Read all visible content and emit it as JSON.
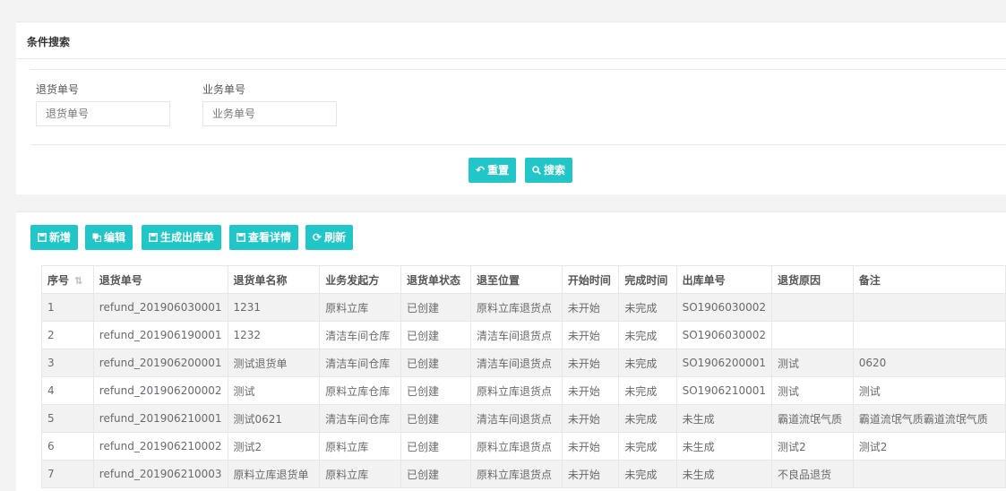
{
  "search": {
    "title": "条件搜索",
    "fields": [
      {
        "label": "退货单号",
        "placeholder": "退货单号",
        "value": ""
      },
      {
        "label": "业务单号",
        "placeholder": "业务单号",
        "value": ""
      }
    ],
    "reset_label": "重置",
    "search_label": "搜索"
  },
  "toolbar": {
    "add_label": "新增",
    "edit_label": "编辑",
    "generate_label": "生成出库单",
    "detail_label": "查看详情",
    "refresh_label": "刷新"
  },
  "colors": {
    "accent": "#23c6c8",
    "row_stripe": "#f2f2f2",
    "background": "#f3f3f4"
  },
  "table": {
    "columns": [
      "序号",
      "退货单号",
      "退货单名称",
      "业务发起方",
      "退货单状态",
      "退至位置",
      "开始时间",
      "完成时间",
      "出库单号",
      "退货原因",
      "备注"
    ],
    "rows": [
      [
        "1",
        "refund_201906030001",
        "1231",
        "原料立库",
        "已创建",
        "原料立库退货点",
        "未开始",
        "未完成",
        "SO1906030002",
        "",
        ""
      ],
      [
        "2",
        "refund_201906190001",
        "1232",
        "清洁车间仓库",
        "已创建",
        "清洁车间退货点",
        "未开始",
        "未完成",
        "SO1906030002",
        "",
        ""
      ],
      [
        "3",
        "refund_201906200001",
        "测试退货单",
        "清洁车间仓库",
        "已创建",
        "清洁车间退货点",
        "未开始",
        "未完成",
        "SO1906200001",
        "测试",
        "0620"
      ],
      [
        "4",
        "refund_201906200002",
        "测试",
        "原料立库仓库",
        "已创建",
        "原料立库退货点",
        "未开始",
        "未完成",
        "SO1906210001",
        "测试",
        "测试"
      ],
      [
        "5",
        "refund_201906210001",
        "测试0621",
        "清洁车间仓库",
        "已创建",
        "清洁车间退货点",
        "未开始",
        "未完成",
        "未生成",
        "霸道流氓气质",
        "霸道流氓气质霸道流氓气质"
      ],
      [
        "6",
        "refund_201906210002",
        "测试2",
        "原料立库",
        "已创建",
        "原料立库退货点",
        "未开始",
        "未完成",
        "未生成",
        "测试2",
        "测试2"
      ],
      [
        "7",
        "refund_201906210003",
        "原料立库退货单",
        "原料立库",
        "已创建",
        "原料立库退货点",
        "未开始",
        "未完成",
        "未生成",
        "不良品退货",
        ""
      ]
    ]
  }
}
